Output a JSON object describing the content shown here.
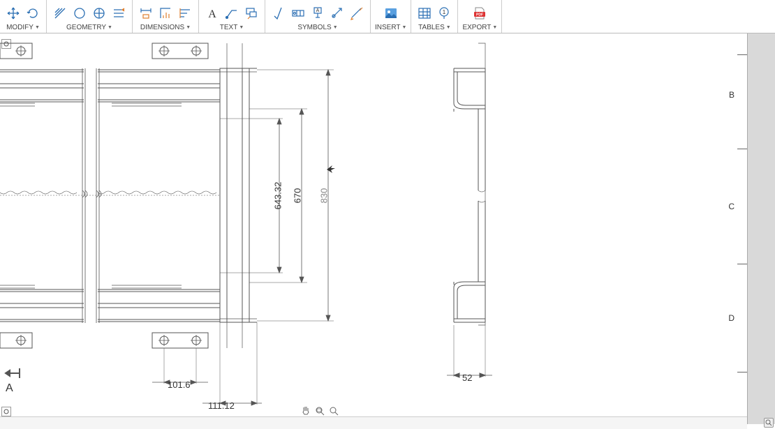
{
  "toolbar": {
    "modify": {
      "label": "MODIFY"
    },
    "geometry": {
      "label": "GEOMETRY"
    },
    "dimensions": {
      "label": "DIMENSIONS"
    },
    "text": {
      "label": "TEXT"
    },
    "symbols": {
      "label": "SYMBOLS"
    },
    "insert": {
      "label": "INSERT"
    },
    "tables": {
      "label": "TABLES"
    },
    "export": {
      "label": "EXPORT"
    }
  },
  "ruler": {
    "b": "B",
    "c": "C",
    "d": "D"
  },
  "dims": {
    "d1": "643.32",
    "d2": "670",
    "d3": "830",
    "d4": "101.6",
    "d5": "111.12",
    "d6": "52",
    "section": "A"
  }
}
